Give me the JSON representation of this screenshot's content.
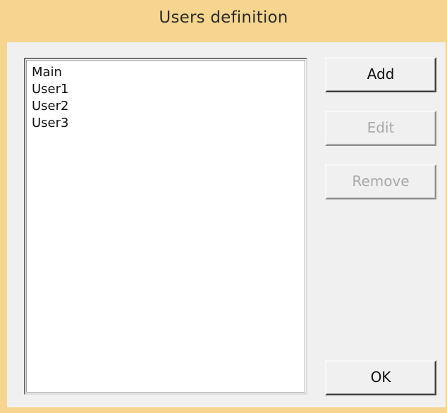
{
  "window": {
    "title": "Users definition"
  },
  "users_list": {
    "items": [
      "Main",
      "User1",
      "User2",
      "User3"
    ]
  },
  "buttons": {
    "add_label": "Add",
    "edit_label": "Edit",
    "remove_label": "Remove",
    "ok_label": "OK"
  },
  "colors": {
    "titlebar_bg": "#f6d58e",
    "client_bg": "#f0f0f0",
    "listbox_bg": "#ffffff",
    "disabled_text": "#a8a8a8"
  }
}
